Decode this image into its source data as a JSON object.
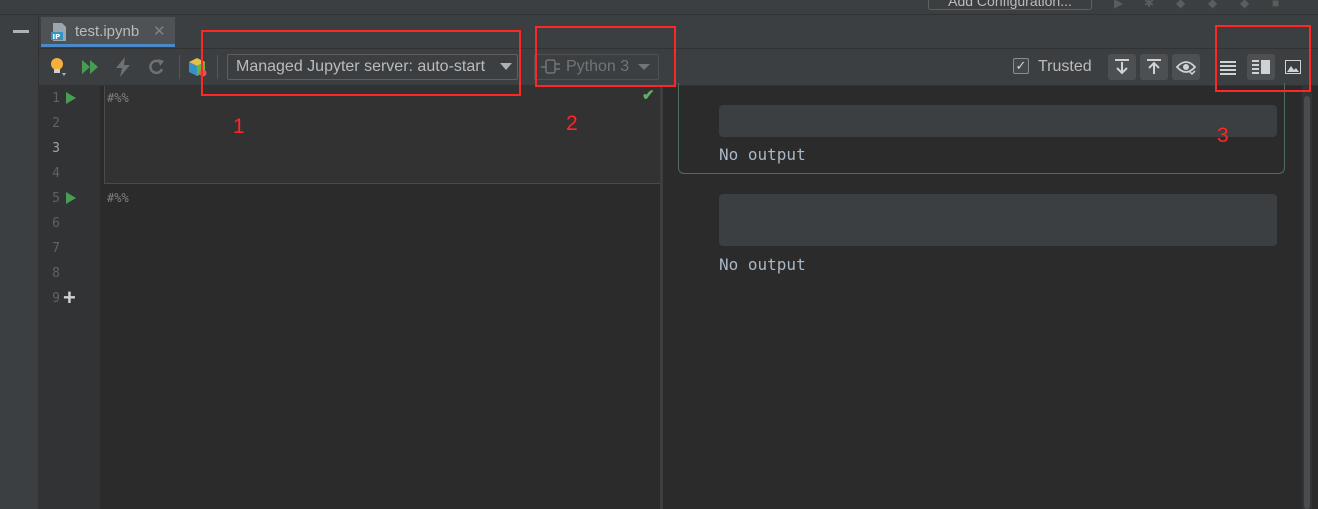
{
  "window": {
    "add_configuration_label": "Add Configuration..."
  },
  "tab": {
    "label": "test.ipynb",
    "close_glyph": "✕",
    "icon": "jupyter-notebook-file-icon"
  },
  "toolbar": {
    "icons": [
      "lightbulb-icon",
      "run-all-icon",
      "interrupt-kernel-icon",
      "restart-kernel-icon",
      "jupyter-logo-icon"
    ],
    "server_label": "Managed Jupyter server: auto-start",
    "kernel_label": "Python 3",
    "trusted_label": "Trusted",
    "trusted_checked": true,
    "view_mode_icons": [
      "editor-only-icon",
      "editor-and-preview-icon",
      "preview-only-icon"
    ],
    "selected_view_mode": "editor-and-preview-icon"
  },
  "editor": {
    "line_numbers": [
      "1",
      "2",
      "3",
      "4",
      "5",
      "6",
      "7",
      "8",
      "9"
    ],
    "cell_marker": "#%%",
    "add_cell_glyph": "+"
  },
  "preview": {
    "outputs": [
      {
        "text": "No output"
      },
      {
        "text": "No output"
      }
    ]
  },
  "annotations": {
    "labels": [
      "1",
      "2",
      "3"
    ],
    "color": "#ff2626"
  },
  "colors": {
    "run_green": "#499c54",
    "accent_blue": "#4a88c7",
    "background": "#2b2b2b"
  }
}
